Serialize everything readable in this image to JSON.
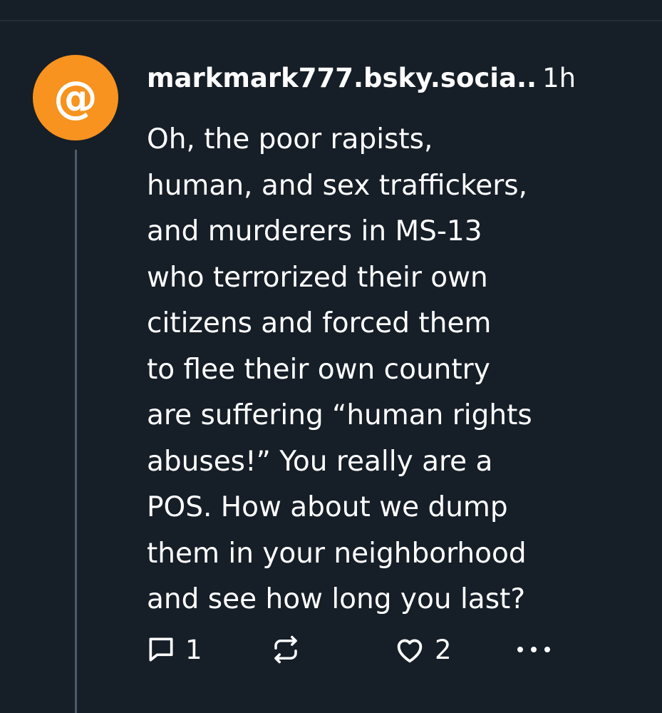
{
  "post": {
    "avatar_symbol": "@",
    "avatar_color": "#f7931e",
    "handle": "markmark777.bsky.socia..",
    "time": "1h",
    "text": "Oh, the poor rapists,\nhuman, and sex traffickers,\nand murderers in MS-13\nwho terrorized their own\ncitizens and forced them\nto flee their own country\nare suffering “human rights\nabuses!” You really are a\nPOS. How about we dump\nthem in your neighborhood\nand see how long you last?",
    "actions": {
      "reply_icon": "reply-icon",
      "reply_count": "1",
      "repost_icon": "repost-icon",
      "like_icon": "heart-icon",
      "like_count": "2",
      "more_icon": "more-icon"
    }
  },
  "colors": {
    "background": "#161e27",
    "thread_line": "#4a5a6e",
    "text": "#ffffff"
  }
}
